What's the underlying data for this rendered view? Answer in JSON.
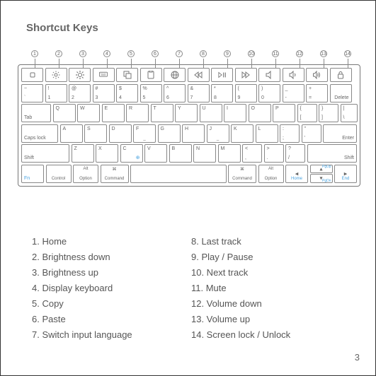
{
  "title": "Shortcut Keys",
  "page_number": "3",
  "callouts": [
    "1",
    "2",
    "3",
    "4",
    "5",
    "6",
    "7",
    "8",
    "9",
    "10",
    "11",
    "12",
    "13",
    "14"
  ],
  "legend": {
    "left": [
      "1. Home",
      "2. Brightness down",
      "3. Brightness up",
      "4. Display keyboard",
      "5. Copy",
      "6. Paste",
      "7. Switch input language"
    ],
    "right": [
      "8. Last track",
      "9. Play /  Pause",
      "10. Next track",
      "11. Mute",
      "12. Volume down",
      "13. Volume up",
      "14. Screen lock / Unlock"
    ]
  },
  "row1": {
    "k1": {
      "t": "~",
      "b": "`"
    },
    "k2": {
      "t": "!",
      "b": "1"
    },
    "k3": {
      "t": "@",
      "b": "2"
    },
    "k4": {
      "t": "#",
      "b": "3"
    },
    "k5": {
      "t": "$",
      "b": "4"
    },
    "k6": {
      "t": "%",
      "b": "5"
    },
    "k7": {
      "t": "^",
      "b": "6"
    },
    "k8": {
      "t": "&",
      "b": "7"
    },
    "k9": {
      "t": "*",
      "b": "8"
    },
    "k10": {
      "t": "(",
      "b": "9"
    },
    "k11": {
      "t": ")",
      "b": "0"
    },
    "k12": {
      "t": "_",
      "b": "-"
    },
    "k13": {
      "t": "+",
      "b": "="
    },
    "del": "Delete"
  },
  "row2": {
    "tab": "Tab",
    "q": "Q",
    "w": "W",
    "e": "E",
    "r": "R",
    "t": "T",
    "y": "Y",
    "u": "U",
    "i": "I",
    "o": "O",
    "p": "P",
    "br1": {
      "t": "{",
      "b": "["
    },
    "br2": {
      "t": "}",
      "b": "]"
    },
    "bs": {
      "t": "|",
      "b": "\\"
    }
  },
  "row3": {
    "caps": "Caps lock",
    "a": "A",
    "s": "S",
    "d": "D",
    "f": "F",
    "g": "G",
    "h": "H",
    "j": "J",
    "k": "K",
    "l": "L",
    "sc": {
      "t": ":",
      "b": ";"
    },
    "qt": {
      "t": "\"",
      "b": "'"
    },
    "enter": "Enter"
  },
  "row4": {
    "shiftL": "Shift",
    "z": "Z",
    "x": "X",
    "c": "C",
    "v": "V",
    "b": "B",
    "n": "N",
    "m": "M",
    "cm": {
      "t": "<",
      "b": ","
    },
    "pd": {
      "t": ">",
      "b": "."
    },
    "sl": {
      "t": "?",
      "b": "/"
    },
    "shiftR": "Shift"
  },
  "row5": {
    "fn": "Fn",
    "ctrl": "Control",
    "altL_t": "Alt",
    "altL_b": "Option",
    "cmdL": "Command",
    "cmdR": "Command",
    "altR_t": "Alt",
    "altR_b": "Option",
    "up_t": "PgUp",
    "dn_t": "PgDn",
    "lf_t": "Home",
    "rt_t": "End"
  }
}
